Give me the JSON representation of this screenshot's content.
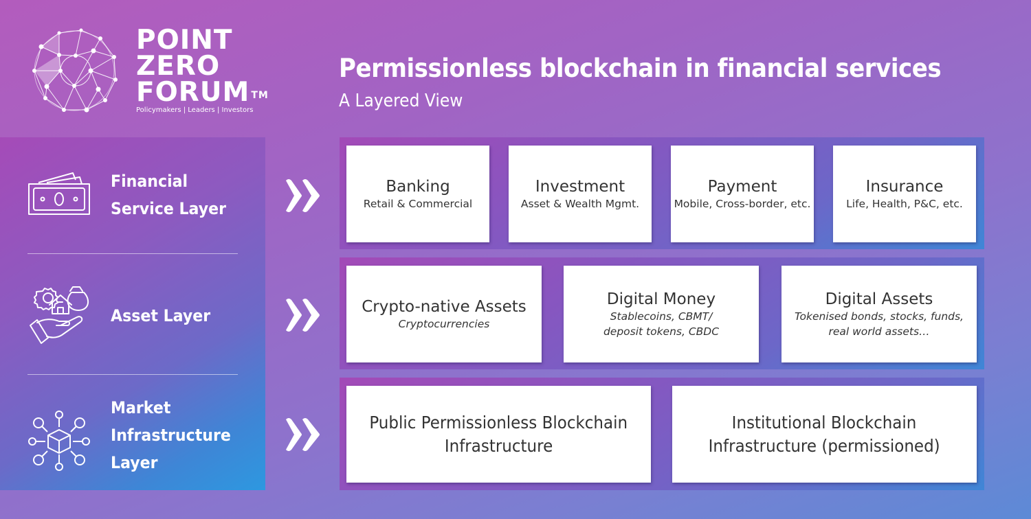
{
  "logo": {
    "words": [
      "POINT",
      "ZERO",
      "FORUM"
    ],
    "trademark": "TM",
    "tagline": "Policymakers | Leaders | Investors"
  },
  "header": {
    "title": "Permissionless blockchain in financial services",
    "subtitle": "A Layered View"
  },
  "layers": [
    {
      "name": "Financial Service Layer",
      "lines": [
        "Financial",
        "Service Layer"
      ],
      "icon": "money-bills-icon"
    },
    {
      "name": "Asset Layer",
      "lines": [
        "Asset Layer"
      ],
      "icon": "hand-assets-icon"
    },
    {
      "name": "Market Infrastructure Layer",
      "lines": [
        "Market",
        "Infrastructure",
        "Layer"
      ],
      "icon": "network-cube-icon"
    }
  ],
  "rows": [
    {
      "cards": [
        {
          "title": "Banking",
          "subtitle": "Retail & Commercial"
        },
        {
          "title": "Investment",
          "subtitle": "Asset & Wealth Mgmt."
        },
        {
          "title": "Payment",
          "subtitle": "Mobile, Cross-border, etc."
        },
        {
          "title": "Insurance",
          "subtitle": "Life, Health, P&C, etc."
        }
      ]
    },
    {
      "cards": [
        {
          "title": "Crypto-native Assets",
          "subtitle_lines": [
            "Cryptocurrencies"
          ]
        },
        {
          "title": "Digital Money",
          "subtitle_lines": [
            "Stablecoins, CBMT/",
            "deposit tokens, CBDC"
          ]
        },
        {
          "title": "Digital Assets",
          "subtitle_lines": [
            "Tokenised bonds, stocks, funds,",
            "real world assets…"
          ]
        }
      ]
    },
    {
      "cards": [
        {
          "title_lines": [
            "Public Permissionless Blockchain",
            "Infrastructure"
          ]
        },
        {
          "title_lines": [
            "Institutional Blockchain",
            "Infrastructure (permissioned)"
          ]
        }
      ]
    }
  ],
  "colors": {
    "text_dark": "#333333",
    "white": "#ffffff",
    "purple": "#a54bb8",
    "blue": "#2d98e0"
  }
}
